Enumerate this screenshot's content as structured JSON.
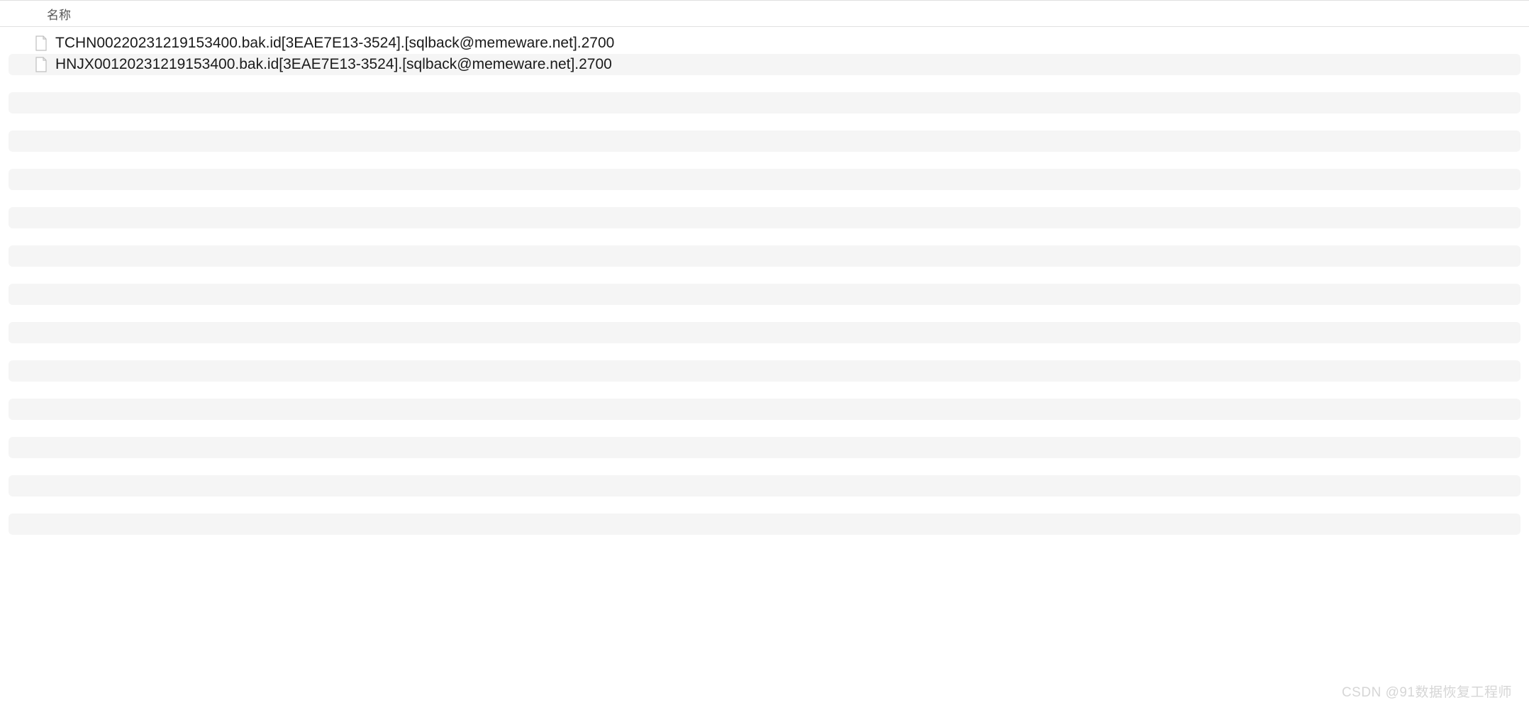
{
  "header": {
    "name_column": "名称"
  },
  "files": [
    {
      "name": "TCHN00220231219153400.bak.id[3EAE7E13-3524].[sqlback@memeware.net].2700"
    },
    {
      "name": "HNJX00120231219153400.bak.id[3EAE7E13-3524].[sqlback@memeware.net].2700"
    }
  ],
  "watermark": "CSDN @91数据恢复工程师"
}
